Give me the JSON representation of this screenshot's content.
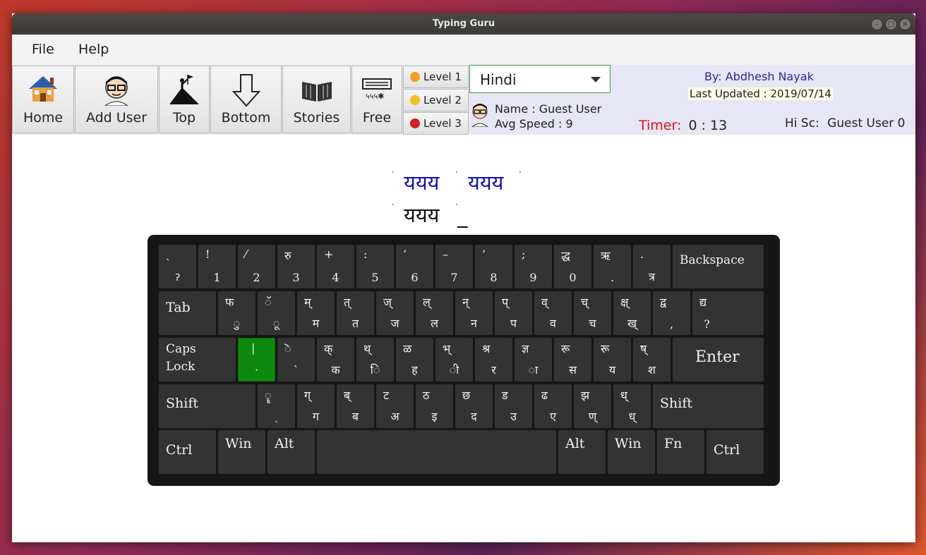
{
  "window": {
    "title": "Typing Guru"
  },
  "menu": {
    "file": "File",
    "help": "Help"
  },
  "toolbar": {
    "home": "Home",
    "add_user": "Add User",
    "top": "Top",
    "bottom": "Bottom",
    "stories": "Stories",
    "free": "Free"
  },
  "levels": [
    {
      "label": "Level 1",
      "color": "#f0a020"
    },
    {
      "label": "Level 2",
      "color": "#f0c020"
    },
    {
      "label": "Level 3",
      "color": "#d02020"
    }
  ],
  "language": {
    "selected": "Hindi"
  },
  "user": {
    "name": "Name : Guest User",
    "avg_speed": "Avg Speed : 9"
  },
  "credits": {
    "by": "By: Abdhesh Nayak",
    "updated": "Last Updated : 2019/07/14"
  },
  "timer": {
    "label": "Timer:",
    "value": "0 : 13"
  },
  "highscore": {
    "label": "Hi Sc:",
    "value": "Guest User 0"
  },
  "exercise": {
    "target_1": "ययय",
    "target_2": "ययय",
    "typed": "ययय",
    "cursor": "_"
  },
  "keyboard": {
    "row1": [
      {
        "top": "ˎ",
        "bot": "ॽ"
      },
      {
        "top": "!",
        "bot": "1"
      },
      {
        "top": "⁄",
        "bot": "2"
      },
      {
        "top": "रु",
        "bot": "3"
      },
      {
        "top": "+",
        "bot": "4"
      },
      {
        "top": ":",
        "bot": "5"
      },
      {
        "top": "‘",
        "bot": "6"
      },
      {
        "top": "–",
        "bot": "7"
      },
      {
        "top": "’",
        "bot": "8"
      },
      {
        "top": ";",
        "bot": "9"
      },
      {
        "top": "द्ध",
        "bot": "0"
      },
      {
        "top": "ऋ",
        "bot": "."
      },
      {
        "top": ".",
        "bot": "त्र"
      },
      {
        "name": "Backspace"
      }
    ],
    "row2": [
      {
        "name": "Tab"
      },
      {
        "top": "फ",
        "bot": "ु"
      },
      {
        "top": "ॅ",
        "bot": "ू"
      },
      {
        "top": "म्",
        "bot": "म"
      },
      {
        "top": "त्",
        "bot": "त"
      },
      {
        "top": "ज्",
        "bot": "ज"
      },
      {
        "top": "ल्",
        "bot": "ल"
      },
      {
        "top": "न्",
        "bot": "न"
      },
      {
        "top": "प्",
        "bot": "प"
      },
      {
        "top": "व्",
        "bot": "व"
      },
      {
        "top": "च्",
        "bot": "च"
      },
      {
        "top": "क्ष्",
        "bot": "ख्"
      },
      {
        "top": "द्व",
        "bot": ","
      },
      {
        "top": "द्य",
        "bot": "?"
      }
    ],
    "row3": [
      {
        "name": "Caps Lock"
      },
      {
        "top": "|",
        "bot": "·"
      },
      {
        "top": "ॆ",
        "bot": "ˋ"
      },
      {
        "top": "क्",
        "bot": "क"
      },
      {
        "top": "थ्",
        "bot": "ि"
      },
      {
        "top": "ळ",
        "bot": "ह"
      },
      {
        "top": "भ्",
        "bot": "ी"
      },
      {
        "top": "श्र",
        "bot": "र"
      },
      {
        "top": "ज्ञ",
        "bot": "ा"
      },
      {
        "top": "रू",
        "bot": "स"
      },
      {
        "top": "रू",
        "bot": "य"
      },
      {
        "top": "ष्",
        "bot": "श"
      },
      {
        "name": "Enter"
      }
    ],
    "row4": [
      {
        "name": "Shift"
      },
      {
        "top": "ॄ",
        "bot": "ˏ"
      },
      {
        "top": "ग्",
        "bot": "ग"
      },
      {
        "top": "ब्",
        "bot": "ब"
      },
      {
        "top": "ट",
        "bot": "अ"
      },
      {
        "top": "ठ",
        "bot": "इ"
      },
      {
        "top": "छ",
        "bot": "द"
      },
      {
        "top": "ड",
        "bot": "उ"
      },
      {
        "top": "ढ",
        "bot": "ए"
      },
      {
        "top": "झ",
        "bot": "ण्"
      },
      {
        "top": "ध्",
        "bot": "ध्"
      },
      {
        "name": "Shift"
      }
    ],
    "row5": [
      {
        "name": "Ctrl"
      },
      {
        "name": "Win"
      },
      {
        "name": "Alt"
      },
      {
        "name": ""
      },
      {
        "name": "Alt"
      },
      {
        "name": "Win"
      },
      {
        "name": "Fn"
      },
      {
        "name": "Ctrl"
      }
    ]
  }
}
